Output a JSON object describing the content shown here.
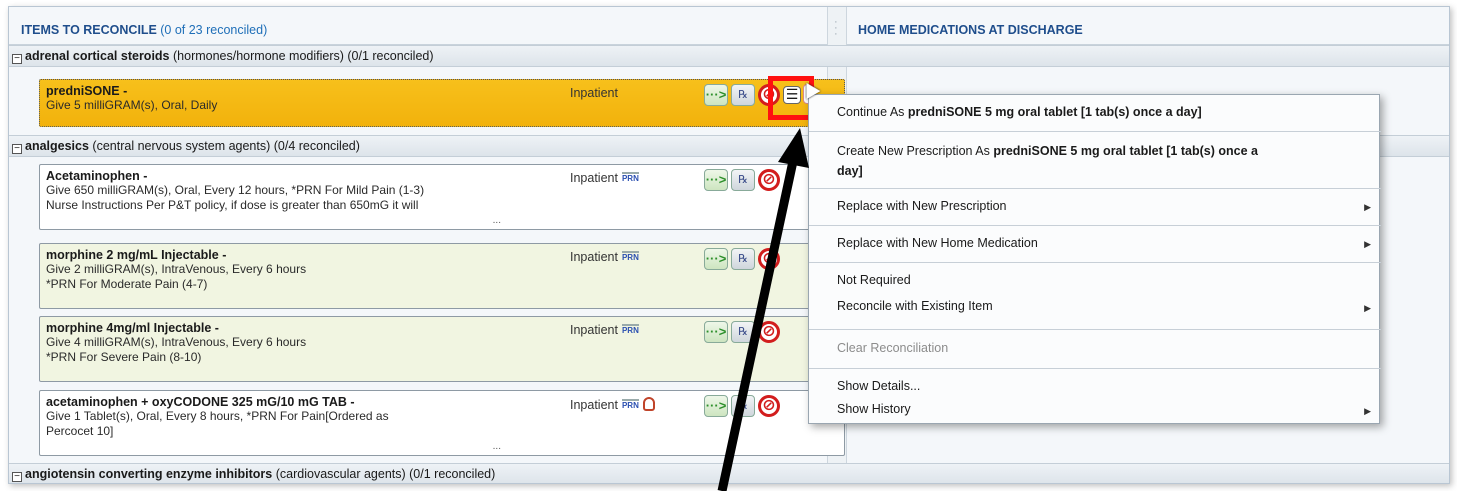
{
  "left_header": {
    "title": "ITEMS TO RECONCILE",
    "count": "(0 of 23 reconciled)"
  },
  "right_header": {
    "title": "HOME MEDICATIONS AT DISCHARGE"
  },
  "groups": [
    {
      "name": "adrenal cortical steroids",
      "detail": "(hormones/hormone modifiers) (0/1 reconciled)"
    },
    {
      "name": "analgesics",
      "detail": "(central nervous system agents) (0/4 reconciled)"
    },
    {
      "name": "angiotensin converting enzyme inhibitors",
      "detail": "(cardiovascular agents) (0/1 reconciled)"
    }
  ],
  "meds": [
    {
      "name": "predniSONE -",
      "line1": "Give 5 milliGRAM(s), Oral, Daily",
      "line2": "",
      "line3": "",
      "status": "Inpatient"
    },
    {
      "name": "Acetaminophen -",
      "line1": "Give 650 milliGRAM(s), Oral, Every 12 hours, *PRN For Mild Pain (1-3)",
      "line2": "Nurse Instructions Per P&T policy, if dose is greater than 650mG it will",
      "line3": "",
      "status": "Inpatient",
      "prn": "PRN",
      "ellipsis": "..."
    },
    {
      "name": "morphine 2 mg/mL Injectable -",
      "line1": "Give 2 milliGRAM(s), IntraVenous, Every 6 hours",
      "line2": "*PRN For Moderate Pain (4-7)",
      "line3": "",
      "status": "Inpatient",
      "prn": "PRN"
    },
    {
      "name": "morphine 4mg/ml Injectable -",
      "line1": "Give 4 milliGRAM(s), IntraVenous, Every 6 hours",
      "line2": "*PRN For Severe Pain (8-10)",
      "line3": "",
      "status": "Inpatient",
      "prn": "PRN"
    },
    {
      "name": "acetaminophen + oxyCODONE 325 mG/10 mG TAB -",
      "line1": "Give 1 Tablet(s), Oral, Every 8 hours, *PRN For Pain[Ordered as",
      "line2": "Percocet 10]",
      "line3": "",
      "status": "Inpatient",
      "prn": "PRN",
      "ellipsis": "..."
    }
  ],
  "context_menu": {
    "continue_prefix": "Continue As ",
    "continue_bold": "predniSONE 5 mg oral tablet [1 tab(s) once a day]",
    "create_prefix": "Create New Prescription As ",
    "create_bold_1": "predniSONE 5 mg oral tablet [1 tab(s) once a",
    "create_bold_2": "day]",
    "replace_rx": "Replace with New Prescription",
    "replace_home": "Replace with New Home Medication",
    "not_required": "Not Required",
    "reconcile_existing": "Reconcile with Existing Item",
    "clear": "Clear Reconciliation",
    "show_details": "Show Details...",
    "show_history": "Show History"
  },
  "icons": {
    "continue": "continue-arrow-icon",
    "prescription": "prescription-icon",
    "stop": "stop-icon",
    "menu": "menu-icon",
    "submenu": "submenu-arrow-icon",
    "prn": "prn-icon",
    "hold": "hold-hand-icon"
  },
  "colors": {
    "header_text": "#1f4e8c",
    "selected_row": "#f5b814",
    "green_row": "#f1f5e1",
    "highlight": "#ff1010",
    "stop": "#d21d1d"
  }
}
